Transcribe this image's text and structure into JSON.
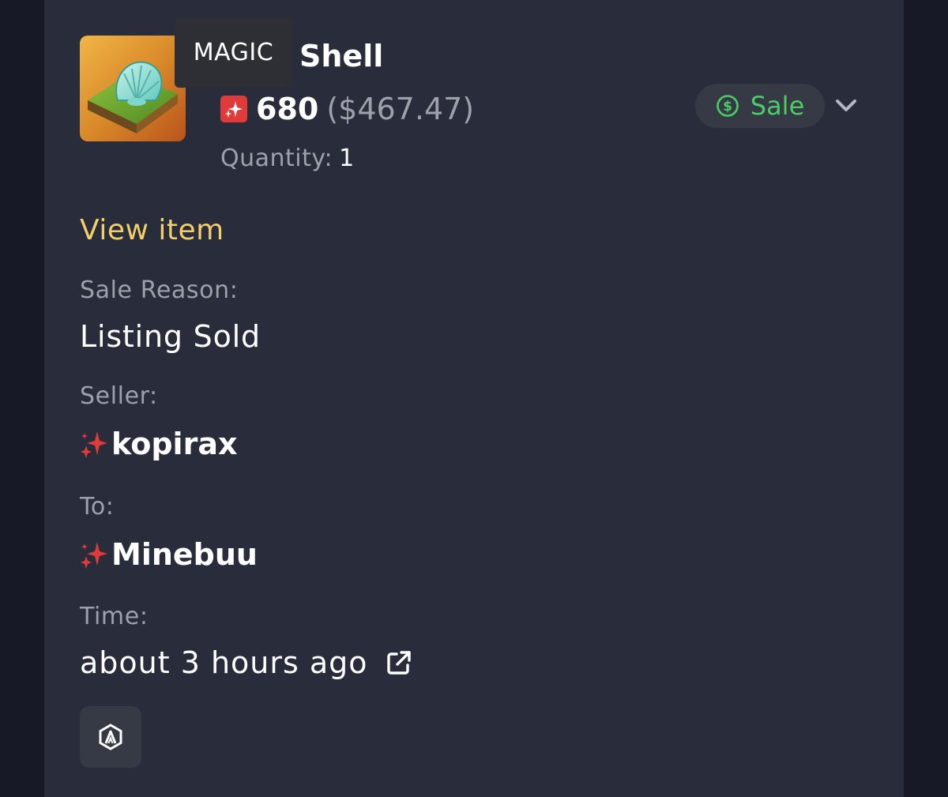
{
  "item": {
    "tooltip": "MAGIC",
    "name": "Shell",
    "price": "680",
    "price_usd": "($467.47)",
    "quantity_label": "Quantity:",
    "quantity_value": "1",
    "image_icon": "shell-nft-image"
  },
  "status": {
    "label": "Sale",
    "icon": "dollar-circle-icon",
    "color": "#4ccc66"
  },
  "actions": {
    "view_item": "View item",
    "view_item_color": "#f3cf6a"
  },
  "details": {
    "sale_reason_label": "Sale Reason:",
    "sale_reason_value": "Listing Sold",
    "seller_label": "Seller:",
    "seller_name": "kopirax",
    "to_label": "To:",
    "to_name": "Minebuu",
    "time_label": "Time:",
    "time_value": "about 3 hours ago"
  },
  "icons": {
    "currency": "magic-sparkle-icon",
    "user": "sparkle-icon",
    "external": "external-link-icon",
    "chain": "arbitrum-icon",
    "expand": "chevron-down-icon"
  }
}
